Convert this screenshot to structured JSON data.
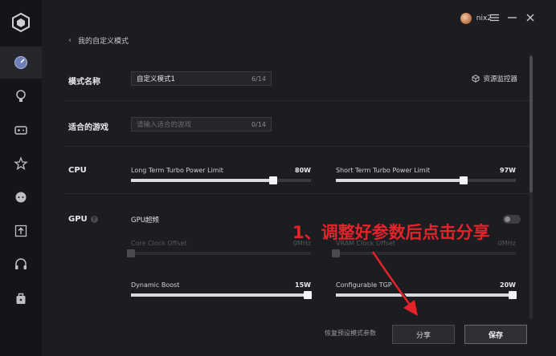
{
  "header": {
    "username": "nix2",
    "breadcrumb": "我的自定义模式"
  },
  "sidebar": {
    "items": [
      {
        "icon": "performance-gauge-icon"
      },
      {
        "icon": "lightbulb-icon"
      },
      {
        "icon": "gamepad-icon"
      },
      {
        "icon": "star-icon"
      },
      {
        "icon": "chat-icon"
      },
      {
        "icon": "upload-icon"
      },
      {
        "icon": "headset-icon"
      },
      {
        "icon": "toolbox-icon"
      }
    ]
  },
  "form": {
    "mode_name_label": "模式名称",
    "mode_name_value": "自定义模式1",
    "mode_name_count": "6/14",
    "games_label": "适合的游戏",
    "games_placeholder": "请输入适合的游戏",
    "games_count": "0/14",
    "monitor_label": "资源监控器"
  },
  "cpu": {
    "label": "CPU",
    "long_term": {
      "name": "Long Term Turbo Power Limit",
      "value": "80W",
      "level_pct": 79
    },
    "short_term": {
      "name": "Short Term Turbo Power Limit",
      "value": "97W",
      "level_pct": 71
    }
  },
  "gpu": {
    "label": "GPU",
    "overclock_label": "GPU超频",
    "overclock_on": false,
    "core_clock": {
      "name": "Core Clock Offset",
      "value": "0MHz",
      "level_pct": 0
    },
    "vram_clock": {
      "name": "VRAM Clock Offset",
      "value": "0MHz",
      "level_pct": 0
    },
    "dynamic_boost": {
      "name": "Dynamic Boost",
      "value": "15W",
      "level_pct": 100
    },
    "tgp": {
      "name": "Configurable TGP",
      "value": "20W",
      "level_pct": 100
    }
  },
  "annotation": "1、调整好参数后点击分享",
  "footer": {
    "restore_label": "恢复预设模式参数",
    "share_label": "分享",
    "save_label": "保存"
  },
  "colors": {
    "accent_red": "#e4232a",
    "background": "#1c1d20",
    "sidebar": "#141518"
  }
}
